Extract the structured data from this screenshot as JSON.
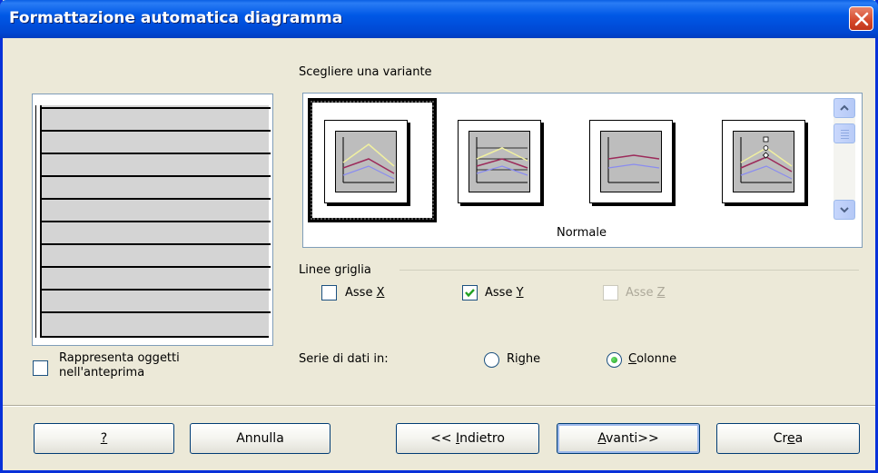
{
  "window": {
    "title": "Formattazione automatica diagramma"
  },
  "variants": {
    "heading": "Scegliere una variante",
    "selected_caption": "Normale",
    "thumbnails": [
      "variant-1",
      "variant-2",
      "variant-3",
      "variant-4"
    ]
  },
  "gridlines": {
    "heading": "Linee griglia",
    "x": {
      "label": "Asse X",
      "checked": false,
      "enabled": true
    },
    "y": {
      "label": "Asse Y",
      "checked": true,
      "enabled": true
    },
    "z": {
      "label": "Asse Z",
      "checked": false,
      "enabled": false
    }
  },
  "series": {
    "label": "Serie di dati in:",
    "rows": {
      "label": "Righe",
      "selected": false
    },
    "columns": {
      "label": "Colonne",
      "selected": true
    }
  },
  "preview_option": {
    "line1": "Rappresenta oggetti",
    "line2": "nell'anteprima",
    "checked": false
  },
  "buttons": {
    "help": "?",
    "cancel": "Annulla",
    "back": "<< Indietro",
    "next": "Avanti>>",
    "create": "Crea"
  },
  "colors": {
    "title_bar": "#0058e6",
    "dialog_bg": "#ece9d8",
    "series_yellow": "#f0f0a0",
    "series_purple": "#9c2a5a",
    "series_blue": "#8a8cf0"
  }
}
